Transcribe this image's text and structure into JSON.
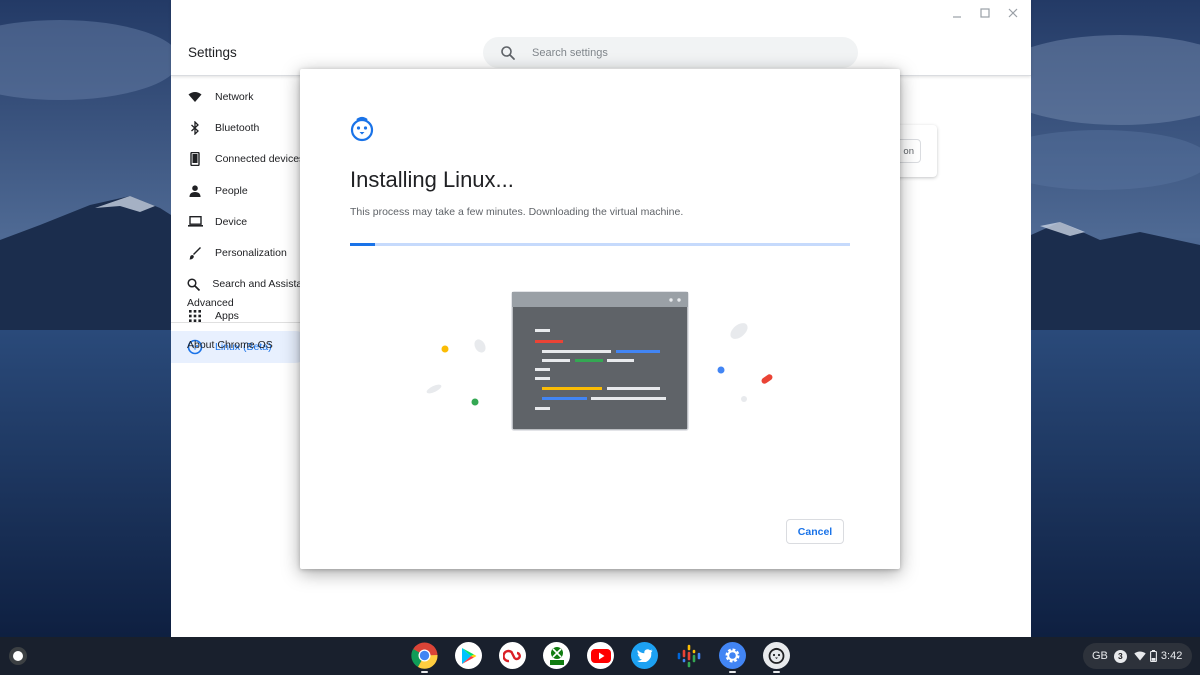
{
  "settings": {
    "title": "Settings",
    "search_placeholder": "Search settings",
    "nav": [
      {
        "label": "Network",
        "icon": "wifi-icon"
      },
      {
        "label": "Bluetooth",
        "icon": "bluetooth-icon"
      },
      {
        "label": "Connected devices",
        "icon": "phone-icon"
      },
      {
        "label": "People",
        "icon": "person-icon"
      },
      {
        "label": "Device",
        "icon": "laptop-icon"
      },
      {
        "label": "Personalization",
        "icon": "brush-icon"
      },
      {
        "label": "Search and Assistant",
        "icon": "search-icon"
      },
      {
        "label": "Apps",
        "icon": "grid-icon"
      },
      {
        "label": "Linux (Beta)",
        "icon": "penguin-icon",
        "active": true
      }
    ],
    "advanced_label": "Advanced",
    "about_label": "About Chrome OS",
    "background_button_label": "on"
  },
  "dialog": {
    "title": "Installing Linux...",
    "message": "This process may take a few minutes. Downloading the virtual machine.",
    "progress": 0.05,
    "cancel_label": "Cancel"
  },
  "shelf": {
    "apps": [
      "chrome-icon",
      "play-store-icon",
      "adobe-creative-cloud-icon",
      "xbox-game-pass-icon",
      "youtube-icon",
      "twitter-icon",
      "google-podcasts-icon",
      "settings-icon",
      "linux-terminal-icon"
    ],
    "status": {
      "ime": "GB",
      "notification_count": "3",
      "time": "3:42"
    }
  },
  "colors": {
    "accent": "#1a73e8",
    "progress_track": "#c6dafc",
    "active_nav_bg": "#e8f0fe",
    "shelf_bg": "#1a202c"
  }
}
